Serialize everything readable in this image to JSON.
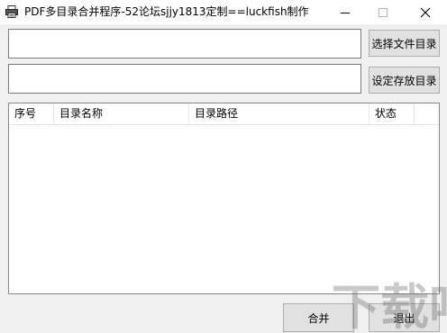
{
  "window": {
    "title": "PDF多目录合并程序-52论坛sjjy1813定制==luckfish制作"
  },
  "inputs": {
    "source_dir_value": "",
    "output_dir_value": ""
  },
  "buttons": {
    "select_files": "选择文件目录",
    "set_save_dir": "设定存放目录",
    "merge": "合并",
    "exit": "退出"
  },
  "table": {
    "columns": [
      "序号",
      "目录名称",
      "目录路径",
      "状态"
    ],
    "rows": []
  },
  "watermark": {
    "text": "下载吧"
  }
}
